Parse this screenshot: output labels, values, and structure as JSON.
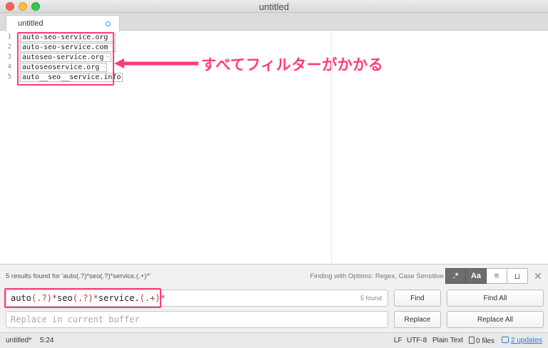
{
  "window": {
    "title": "untitled"
  },
  "tab": {
    "label": "untitled"
  },
  "editor": {
    "lines": [
      {
        "num": "1",
        "text": "auto-seo-service.org"
      },
      {
        "num": "2",
        "text": "auto-seo-service.com"
      },
      {
        "num": "3",
        "text": "autoseo-service.org"
      },
      {
        "num": "4",
        "text": "autoseoservice.org"
      },
      {
        "num": "5",
        "text": "auto__seo__service.info"
      }
    ],
    "annotation": "すべてフィルターがかかる"
  },
  "find": {
    "status": "5 results found for 'auto(.?)*seo(.?)*service.(.+)*'",
    "options_label": "Finding with Options: Regex, Case Sensitive",
    "options": [
      {
        "label": ".*",
        "on": true
      },
      {
        "label": "Aa",
        "on": true
      },
      {
        "label": "≡",
        "on": false
      },
      {
        "label": "⊔",
        "on": false
      }
    ],
    "close": "✕",
    "query_parts": [
      "auto",
      "(.?)",
      "*",
      "seo",
      "(.?)",
      "*",
      "service.",
      "(.+)",
      "*"
    ],
    "count": "5 found",
    "replace_placeholder": "Replace in current buffer",
    "replace_value": "",
    "find_label": "Find",
    "find_all_label": "Find All",
    "replace_label": "Replace",
    "replace_all_label": "Replace All"
  },
  "status": {
    "file": "untitled*",
    "position": "5:24",
    "line_ending": "LF",
    "encoding": "UTF-8",
    "syntax": "Plain Text",
    "files": "0 files",
    "updates": "2 updates"
  },
  "colors": {
    "accent": "#ff3b7a",
    "link": "#2f7bd8"
  }
}
